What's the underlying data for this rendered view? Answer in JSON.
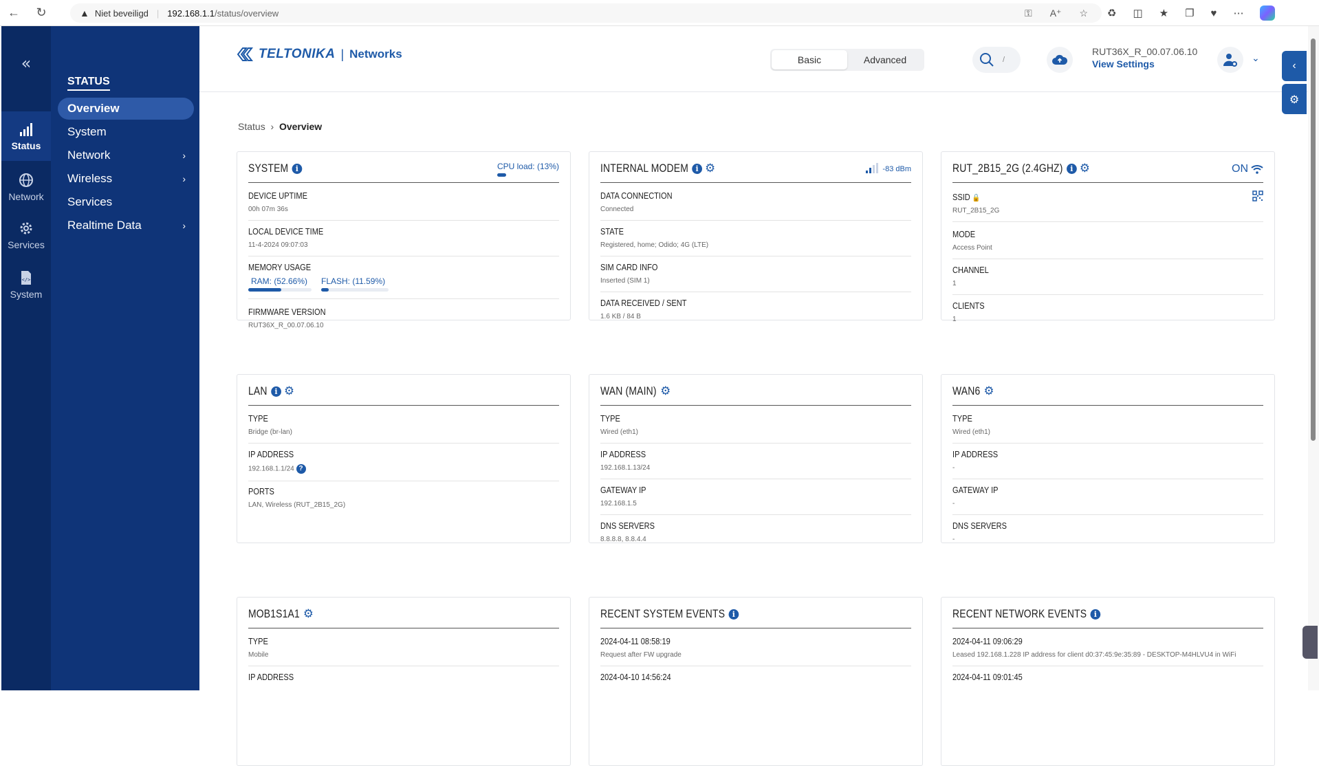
{
  "browser": {
    "insecure_label": "Niet beveiligd",
    "url_host": "192.168.1.1",
    "url_path": "/status/overview"
  },
  "rail": {
    "items": [
      {
        "label": "Status",
        "icon": "signal-bars-icon",
        "active": true
      },
      {
        "label": "Network",
        "icon": "globe-icon"
      },
      {
        "label": "Services",
        "icon": "gear-icon"
      },
      {
        "label": "System",
        "icon": "file-code-icon"
      }
    ]
  },
  "menu": {
    "heading": "STATUS",
    "items": [
      {
        "label": "Overview",
        "active": true
      },
      {
        "label": "System"
      },
      {
        "label": "Network",
        "has_children": true
      },
      {
        "label": "Wireless",
        "has_children": true
      },
      {
        "label": "Services"
      },
      {
        "label": "Realtime Data",
        "has_children": true
      }
    ]
  },
  "topbar": {
    "brand": "TELTONIKA",
    "brand_suffix": "Networks",
    "mode_basic": "Basic",
    "mode_advanced": "Advanced",
    "search_shortcut": "/",
    "firmware_version": "RUT36X_R_00.07.06.10",
    "view_settings": "View Settings"
  },
  "breadcrumb": {
    "parent": "Status",
    "current": "Overview"
  },
  "cards": {
    "system": {
      "title": "SYSTEM",
      "cpu_load": "CPU load: (13%)",
      "cpu_pct": 13,
      "uptime_label": "DEVICE UPTIME",
      "uptime": "00h 07m 36s",
      "time_label": "LOCAL DEVICE TIME",
      "time": "11-4-2024 09:07:03",
      "memory_label": "MEMORY USAGE",
      "ram": "RAM: (52.66%)",
      "ram_pct": 52.66,
      "flash": "FLASH: (11.59%)",
      "flash_pct": 11.59,
      "firmware_label": "FIRMWARE VERSION",
      "firmware": "RUT36X_R_00.07.06.10"
    },
    "modem": {
      "title": "INTERNAL MODEM",
      "signal": "-83 dBm",
      "signal_bars": 2,
      "data_conn_label": "DATA CONNECTION",
      "data_conn": "Connected",
      "state_label": "STATE",
      "state": "Registered, home; Odido; 4G (LTE)",
      "sim_label": "SIM CARD INFO",
      "sim": "Inserted (SIM 1)",
      "data_label": "DATA RECEIVED / SENT",
      "data": "1.6 KB / 84 B"
    },
    "wifi": {
      "title": "RUT_2B15_2G (2.4GHZ)",
      "status": "ON",
      "ssid_label": "SSID",
      "ssid": "RUT_2B15_2G",
      "mode_label": "MODE",
      "mode": "Access Point",
      "channel_label": "CHANNEL",
      "channel": "1",
      "clients_label": "CLIENTS",
      "clients": "1"
    },
    "lan": {
      "title": "LAN",
      "type_label": "TYPE",
      "type": "Bridge (br-lan)",
      "ip_label": "IP ADDRESS",
      "ip": "192.168.1.1/24",
      "ports_label": "PORTS",
      "ports": "LAN, Wireless (RUT_2B15_2G)"
    },
    "wan": {
      "title": "WAN (MAIN)",
      "type_label": "TYPE",
      "type": "Wired (eth1)",
      "ip_label": "IP ADDRESS",
      "ip": "192.168.1.13/24",
      "gw_label": "GATEWAY IP",
      "gw": "192.168.1.5",
      "dns_label": "DNS SERVERS",
      "dns": "8.8.8.8, 8.8.4.4"
    },
    "wan6": {
      "title": "WAN6",
      "type_label": "TYPE",
      "type": "Wired (eth1)",
      "ip_label": "IP ADDRESS",
      "ip": "-",
      "gw_label": "GATEWAY IP",
      "gw": "-",
      "dns_label": "DNS SERVERS",
      "dns": "-"
    },
    "mob": {
      "title": "MOB1S1A1",
      "type_label": "TYPE",
      "type": "Mobile",
      "ip_label": "IP ADDRESS"
    },
    "sysevents": {
      "title": "RECENT SYSTEM EVENTS",
      "events": [
        {
          "time": "2024-04-11 08:58:19",
          "text": "Request after FW upgrade"
        },
        {
          "time": "2024-04-10 14:56:24",
          "text": ""
        }
      ]
    },
    "netevents": {
      "title": "RECENT NETWORK EVENTS",
      "events": [
        {
          "time": "2024-04-11 09:06:29",
          "text": "Leased 192.168.1.228 IP address for client d0:37:45:9e:35:89 - DESKTOP-M4HLVU4 in WiFi"
        },
        {
          "time": "2024-04-11 09:01:45",
          "text": ""
        }
      ]
    }
  },
  "colors": {
    "accent": "#1e5aa8",
    "rail": "#0b2a63",
    "menu": "#0f3478"
  }
}
